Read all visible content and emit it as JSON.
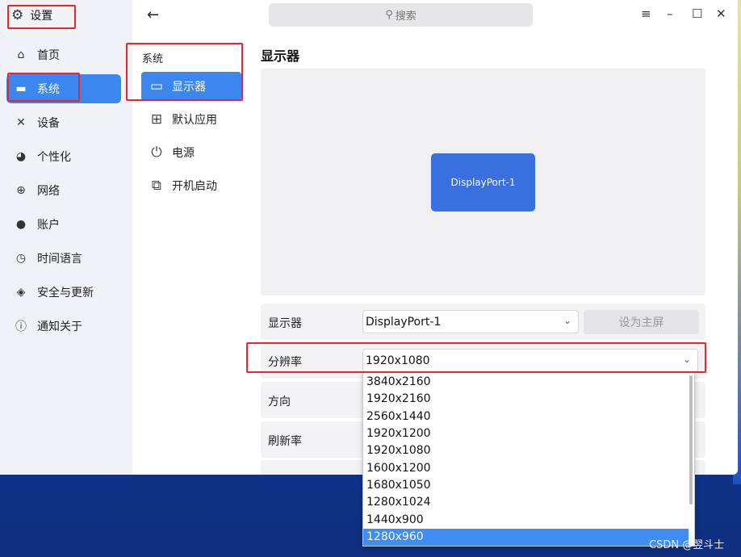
{
  "app": {
    "title": "设置"
  },
  "search": {
    "placeholder": "搜索"
  },
  "sidebar": {
    "items": [
      {
        "label": "首页",
        "icon": "home-icon"
      },
      {
        "label": "系统",
        "icon": "monitor-icon"
      },
      {
        "label": "设备",
        "icon": "tools-icon"
      },
      {
        "label": "个性化",
        "icon": "palette-icon"
      },
      {
        "label": "网络",
        "icon": "globe-icon"
      },
      {
        "label": "账户",
        "icon": "user-icon"
      },
      {
        "label": "时间语言",
        "icon": "clock-icon"
      },
      {
        "label": "安全与更新",
        "icon": "shield-icon"
      },
      {
        "label": "通知关于",
        "icon": "info-icon"
      }
    ],
    "active_index": 1
  },
  "subnav": {
    "header": "系统",
    "items": [
      {
        "label": "显示器",
        "icon": "monitor-icon"
      },
      {
        "label": "默认应用",
        "icon": "apps-grid-icon"
      },
      {
        "label": "电源",
        "icon": "power-icon"
      },
      {
        "label": "开机启动",
        "icon": "startup-icon"
      }
    ],
    "active_index": 0
  },
  "main": {
    "title": "显示器",
    "preview": {
      "monitor_name": "DisplayPort-1"
    },
    "monitor_row": {
      "label": "显示器",
      "value": "DisplayPort-1",
      "primary_button": "设为主屏"
    },
    "resolution_row": {
      "label": "分辨率",
      "value": "1920x1080"
    },
    "orientation_row": {
      "label": "方向"
    },
    "refresh_row": {
      "label": "刷新率"
    }
  },
  "dropdown": {
    "options": [
      "3840x2160",
      "1920x2160",
      "2560x1440",
      "1920x1200",
      "1920x1080",
      "1600x1200",
      "1680x1050",
      "1280x1024",
      "1440x900",
      "1280x960"
    ],
    "highlighted_index": 9
  },
  "watermark": "CSDN @翌斗士",
  "colors": {
    "accent": "#3c86f0",
    "annotation": "#e8262c"
  }
}
